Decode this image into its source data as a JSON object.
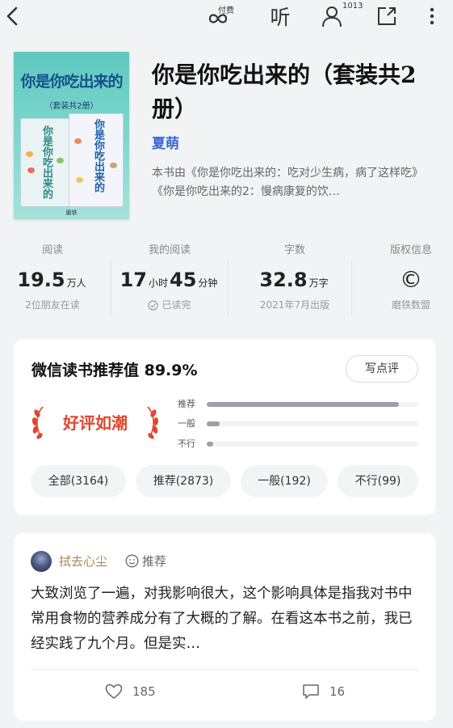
{
  "topbar": {
    "paid_label": "付费",
    "listen_label": "听",
    "readers_count": "1013"
  },
  "book": {
    "cover": {
      "title": "你是你吃出来的",
      "subtitle": "（套装共2册）",
      "book1_title": "你是你吃出来的",
      "book2_title": "你是你吃出来的",
      "publisher": "磨铁"
    },
    "title": "你是你吃出来的（套装共2册）",
    "author": "夏萌",
    "description": "本书由《你是你吃出来的：吃对少生病，病了这样吃》《你是你吃出来的2：慢病康复的饮…"
  },
  "stats": [
    {
      "label": "阅读",
      "value": "19.5",
      "unit": "万人",
      "note": "2位朋友在读"
    },
    {
      "label": "我的阅读",
      "value1": "17",
      "unit1": "小时",
      "value2": "45",
      "unit2": "分钟",
      "note": "已读完"
    },
    {
      "label": "字数",
      "value": "32.8",
      "unit": "万字",
      "note": "2021年7月出版"
    },
    {
      "label": "版权信息",
      "symbol": "©",
      "note": "磨铁数盟"
    }
  ],
  "recommend": {
    "title": "微信读书推荐值 89.9%",
    "write_label": "写点评",
    "badge": "好评如潮",
    "bars": [
      {
        "label": "推荐",
        "fraction": 0.91
      },
      {
        "label": "一般",
        "fraction": 0.06
      },
      {
        "label": "不行",
        "fraction": 0.03
      }
    ],
    "filters": [
      "全部(3164)",
      "推荐(2873)",
      "一般(192)",
      "不行(99)"
    ]
  },
  "review": {
    "user_name": "拭去心尘",
    "tag": "推荐",
    "text": "大致浏览了一遍，对我影响很大，这个影响具体是指我对书中常用食物的营养成分有了大概的了解。在看这本书之前，我已经实践了九个月。但是实…",
    "likes": "185",
    "comments": "16"
  },
  "colors": {
    "author": "#3a66d6",
    "badge": "#e0462c",
    "reviewer": "#a8894f",
    "bar": "#9aa0a8"
  }
}
